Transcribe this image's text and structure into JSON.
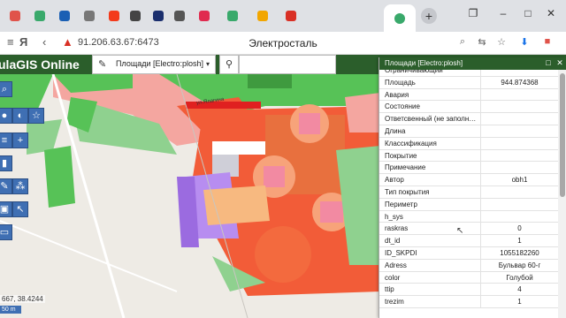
{
  "browser": {
    "tabs": [
      {
        "icon": "grid-icon",
        "color": "#e0534a"
      },
      {
        "icon": "globe-icon",
        "color": "#39a96b"
      },
      {
        "icon": "mail-icon",
        "color": "#1a5fb4"
      },
      {
        "icon": "yandex-icon",
        "color": "#777777"
      },
      {
        "icon": "yandex-icon",
        "color": "#f33a1b"
      },
      {
        "icon": "speed-icon",
        "color": "#444444"
      },
      {
        "icon": "chart-icon",
        "color": "#1b2f6e"
      },
      {
        "icon": "doc-icon",
        "color": "#555555"
      },
      {
        "icon": "game-icon",
        "color": "#e02b4f"
      },
      {
        "icon": "globe-icon",
        "color": "#39a96b"
      },
      {
        "icon": "mail-icon",
        "color": "#f2a600"
      },
      {
        "icon": "map-pin-icon",
        "color": "#d93025"
      }
    ],
    "active_tab_icon_color": "#39a96b",
    "url": "91.206.63.67:6473",
    "page_title": "Электросталь",
    "yandex_label": "Я"
  },
  "app": {
    "title": "ulaGIS Online",
    "layer_select": "Площади [Electro:plosh]"
  },
  "map": {
    "street_label": "ул.Ялагина",
    "coords": "667, 38.4244",
    "scale": "50 m"
  },
  "panel": {
    "title": "Площади [Electro:plosh]",
    "rows": [
      {
        "key": "Ограничивающий",
        "value": ""
      },
      {
        "key": "Площадь",
        "value": "944.874368"
      },
      {
        "key": "Авария",
        "value": ""
      },
      {
        "key": "Состояние",
        "value": ""
      },
      {
        "key": "Ответсвенный (не заполн…",
        "value": ""
      },
      {
        "key": "Длина",
        "value": ""
      },
      {
        "key": "Классификация",
        "value": ""
      },
      {
        "key": "Покрытие",
        "value": ""
      },
      {
        "key": "Примечание",
        "value": ""
      },
      {
        "key": "Автор",
        "value": "obh1"
      },
      {
        "key": "Тип покрытия",
        "value": ""
      },
      {
        "key": "Периметр",
        "value": ""
      },
      {
        "key": "h_sys",
        "value": ""
      },
      {
        "key": "raskras",
        "value": "0"
      },
      {
        "key": "dt_id",
        "value": "1"
      },
      {
        "key": "ID_SKPDI",
        "value": "1055182260"
      },
      {
        "key": "Adress",
        "value": "Бульвар 60-г"
      },
      {
        "key": "color",
        "value": "Голубой"
      },
      {
        "key": "ttip",
        "value": "4"
      },
      {
        "key": "trezim",
        "value": "1"
      }
    ]
  }
}
